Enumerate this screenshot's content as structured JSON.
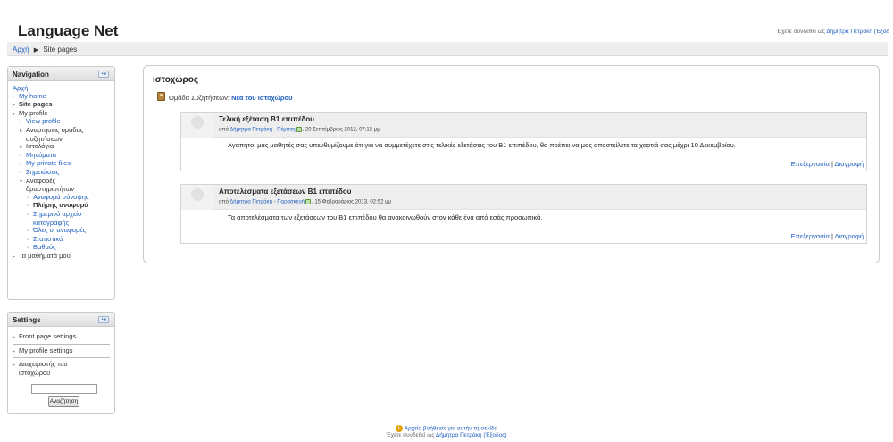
{
  "header": {
    "site_title": "Language Net",
    "login_prefix": "Έχετε συνδεθεί ως",
    "login_user": "Δήμητρα Πετράκη (Έξοδ"
  },
  "breadcrumb": {
    "home": "Αρχή",
    "current": "Site pages"
  },
  "navigation": {
    "title": "Navigation",
    "home": "Αρχή",
    "my_home": "My home",
    "site_pages": "Site pages",
    "my_profile": "My profile",
    "view_profile": "View profile",
    "forum_posts_1": "Αναρτήσεις ομάδας",
    "forum_posts_2": "συζητήσεων",
    "blogs": "Ιστολόγια",
    "messages": "Μηνύματα",
    "private_files": "My private files",
    "notes": "Σημειώσεις",
    "activity_reports_1": "Αναφορές",
    "activity_reports_2": "δραστηριοτήτων",
    "outline_report": "Αναφορά σύνοψης",
    "complete_report": "Πλήρης αναφορά",
    "today_logs_1": "Σημερινό αρχείο",
    "today_logs_2": "καταγραφής",
    "all_logs": "Όλες οι αναφορές",
    "statistics": "Στατιστικά",
    "grade": "Βαθμός",
    "my_courses": "Τα μαθήματά μου"
  },
  "settings": {
    "title": "Settings",
    "front_page": "Front page settings",
    "my_profile_settings": "My profile settings",
    "site_admin_1": "Διαχειριστής του",
    "site_admin_2": "ιστοχώρου",
    "search_placeholder": "",
    "search_button": "Αναζήτηση"
  },
  "main": {
    "title": "ιστοχώρος",
    "forum_group": "Ομάδα Συζητήσεων:",
    "forum_name": "Νέα του ιστοχώρου",
    "posts": [
      {
        "subject": "Τελική εξέταση Β1 επιπέδου",
        "by": "από",
        "author": "Δήμητρα Πετράκη",
        "tag": "Πέμπτη",
        "date": ", 20 Σεπτέμβριος 2012, 07:12 μμ",
        "body": "Αγαπητοί μας μαθητές σας υπενθυμίζουμε ότι για να συμμετέχετε στις τελικές εξετάσεις του Β1 επιπέδου, θα πρέπει να μας αποστείλετε τα χαρτιά σας μέχρι  10 Δεκεμβρίου.",
        "edit": "Επεξεργασία",
        "delete": "Διαγραφή"
      },
      {
        "subject": "Αποτελέσματα εξετάσεων Β1 επιπέδου",
        "by": "από",
        "author": "Δήμητρα Πετράκη",
        "tag": "Παρασκευή",
        "date": ", 15 Φεβρουάριος 2013, 02:52 μμ",
        "body": "Τα αποτελέσματα  των εξετάσεων του  Β1 επιπέδου θα ανακοινωθούν στον κάθε ένα από εσάς  προσωπικά.",
        "edit": "Επεξεργασία",
        "delete": "Διαγραφή"
      }
    ]
  },
  "footer": {
    "help_link": "Αρχείο βοήθειας για αυτήν τη σελίδα",
    "login_prefix": "Έχετε συνδεθεί ως",
    "login_user": "Δήμητρα Πετράκη (Έξοδος)"
  }
}
